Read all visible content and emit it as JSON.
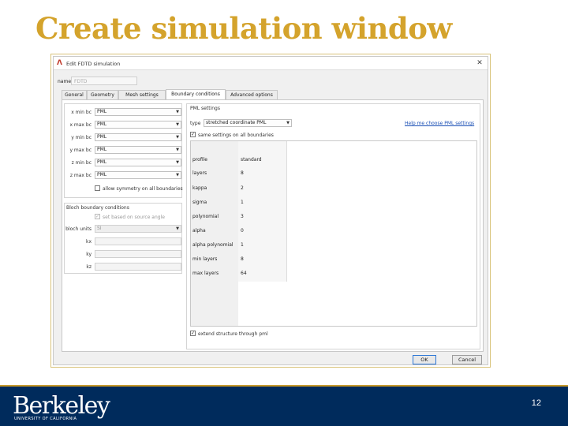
{
  "slide": {
    "title": "Create simulation window",
    "page_number": "12",
    "logo": "Berkeley",
    "logo_sub": "UNIVERSITY OF CALIFORNIA"
  },
  "dialog": {
    "window_title": "Edit FDTD simulation",
    "name_label": "name",
    "name_value": "FDTD",
    "tabs": [
      {
        "label": "General"
      },
      {
        "label": "Geometry"
      },
      {
        "label": "Mesh settings"
      },
      {
        "label": "Boundary conditions"
      },
      {
        "label": "Advanced options"
      }
    ],
    "boundaries": [
      {
        "label": "x min bc",
        "value": "PML"
      },
      {
        "label": "x max bc",
        "value": "PML"
      },
      {
        "label": "y min bc",
        "value": "PML"
      },
      {
        "label": "y max bc",
        "value": "PML"
      },
      {
        "label": "z min bc",
        "value": "PML"
      },
      {
        "label": "z max bc",
        "value": "PML"
      }
    ],
    "allow_symmetry": "allow symmetry on all boundaries",
    "bloch": {
      "title": "Bloch boundary conditions",
      "set_based_on_source": "set based on source angle",
      "units_label": "bloch units",
      "units_value": "SI",
      "kx_label": "kx",
      "ky_label": "ky",
      "kz_label": "kz"
    },
    "pml": {
      "title": "PML settings",
      "type_label": "type",
      "type_value": "stretched coordinate PML",
      "help_link": "Help me choose PML settings",
      "same_settings": "same settings on all boundaries",
      "rows": [
        {
          "name": "profile",
          "value": "standard"
        },
        {
          "name": "layers",
          "value": "8"
        },
        {
          "name": "kappa",
          "value": "2"
        },
        {
          "name": "sigma",
          "value": "1"
        },
        {
          "name": "polynomial",
          "value": "3"
        },
        {
          "name": "alpha",
          "value": "0"
        },
        {
          "name": "alpha polynomial",
          "value": "1"
        },
        {
          "name": "min layers",
          "value": "8"
        },
        {
          "name": "max layers",
          "value": "64"
        }
      ],
      "extend_structure": "extend structure through pml"
    },
    "ok_label": "OK",
    "cancel_label": "Cancel"
  }
}
